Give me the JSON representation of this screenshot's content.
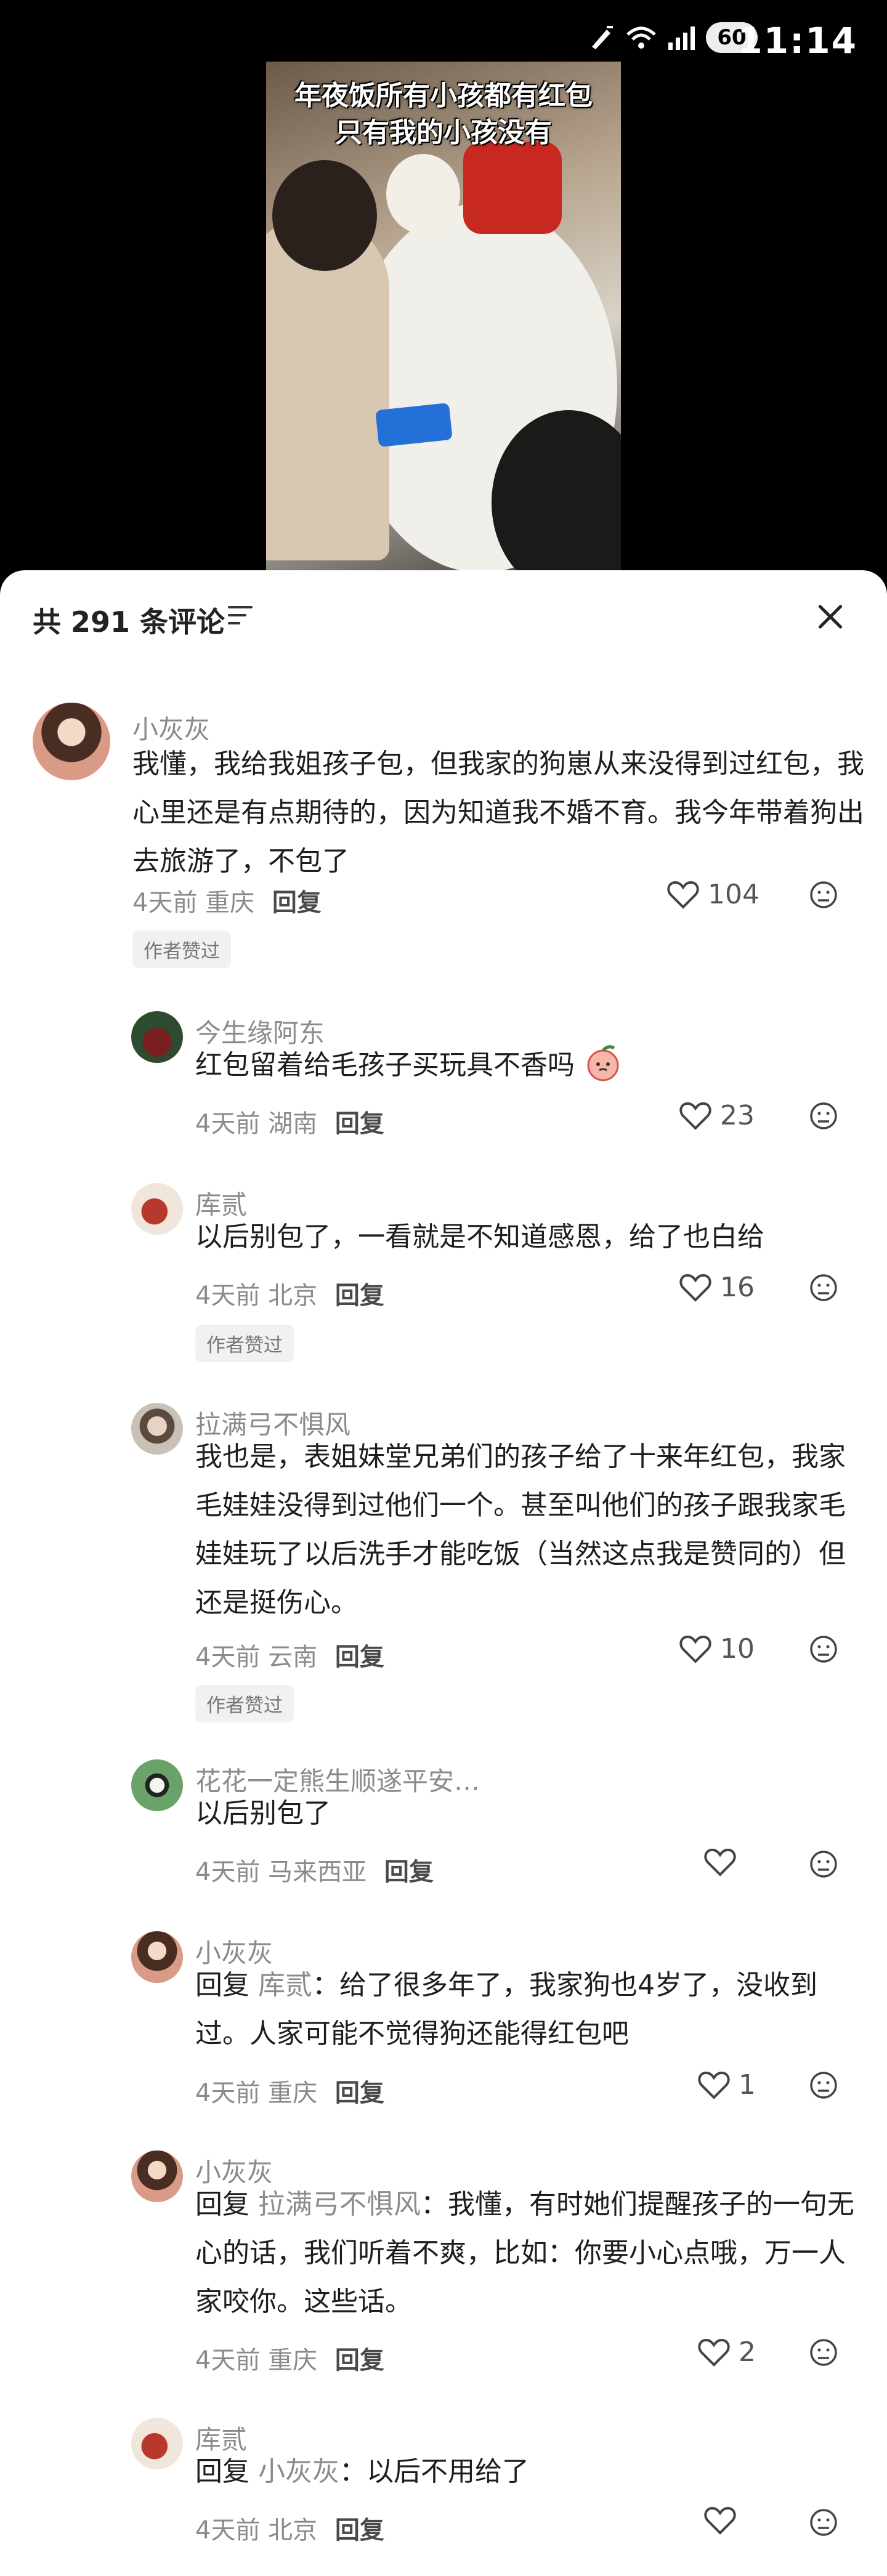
{
  "status_bar": {
    "time": "11:14",
    "battery": "60"
  },
  "video": {
    "caption_line1": "年夜饭所有小孩都有红包",
    "caption_line2": "只有我的小孩没有"
  },
  "comments_panel": {
    "title": "共 291 条评论"
  },
  "comments": [
    {
      "name": "小灰灰",
      "text": "我懂，我给我姐孩子包，但我家的狗崽从来没得到过红包，我心里还是有点期待的，因为知道我不婚不育。我今年带着狗出去旅游了，不包了",
      "time": "4天前",
      "location": "重庆",
      "reply": "回复",
      "likes": "104",
      "badge": "作者赞过"
    },
    {
      "name": "今生缘阿东",
      "text": "红包留着给毛孩子买玩具不香吗",
      "time": "4天前",
      "location": "湖南",
      "reply": "回复",
      "likes": "23"
    },
    {
      "name": "库贰",
      "text": "以后别包了，一看就是不知道感恩，给了也白给",
      "time": "4天前",
      "location": "北京",
      "reply": "回复",
      "likes": "16",
      "badge": "作者赞过"
    },
    {
      "name": "拉满弓不惧风",
      "text": "我也是，表姐妹堂兄弟们的孩子给了十来年红包，我家毛娃娃没得到过他们一个。甚至叫他们的孩子跟我家毛娃娃玩了以后洗手才能吃饭（当然这点我是赞同的）但还是挺伤心。",
      "time": "4天前",
      "location": "云南",
      "reply": "回复",
      "likes": "10",
      "badge": "作者赞过"
    },
    {
      "name": "花花一定熊生顺遂平安…",
      "text": "以后别包了",
      "time": "4天前",
      "location": "马来西亚",
      "reply": "回复",
      "likes": ""
    },
    {
      "name": "小灰灰",
      "prefix": "回复",
      "mention": "库贰",
      "text": "：给了很多年了，我家狗也4岁了，没收到过。人家可能不觉得狗还能得红包吧",
      "time": "4天前",
      "location": "重庆",
      "reply": "回复",
      "likes": "1"
    },
    {
      "name": "小灰灰",
      "prefix": "回复",
      "mention": "拉满弓不惧风",
      "text": "：我懂，有时她们提醒孩子的一句无心的话，我们听着不爽，比如：你要小心点哦，万一人家咬你。这些话。",
      "time": "4天前",
      "location": "重庆",
      "reply": "回复",
      "likes": "2"
    },
    {
      "name": "库贰",
      "prefix": "回复",
      "mention": "小灰灰",
      "text": "：以后不用给了",
      "time": "4天前",
      "location": "北京",
      "reply": "回复",
      "likes": ""
    }
  ],
  "icons": {
    "heart": "heart-outline-icon",
    "dislike": "dislike-face-icon",
    "close": "close-icon",
    "filter": "sort-filter-icon",
    "emoji": "peach-emoji-icon"
  }
}
